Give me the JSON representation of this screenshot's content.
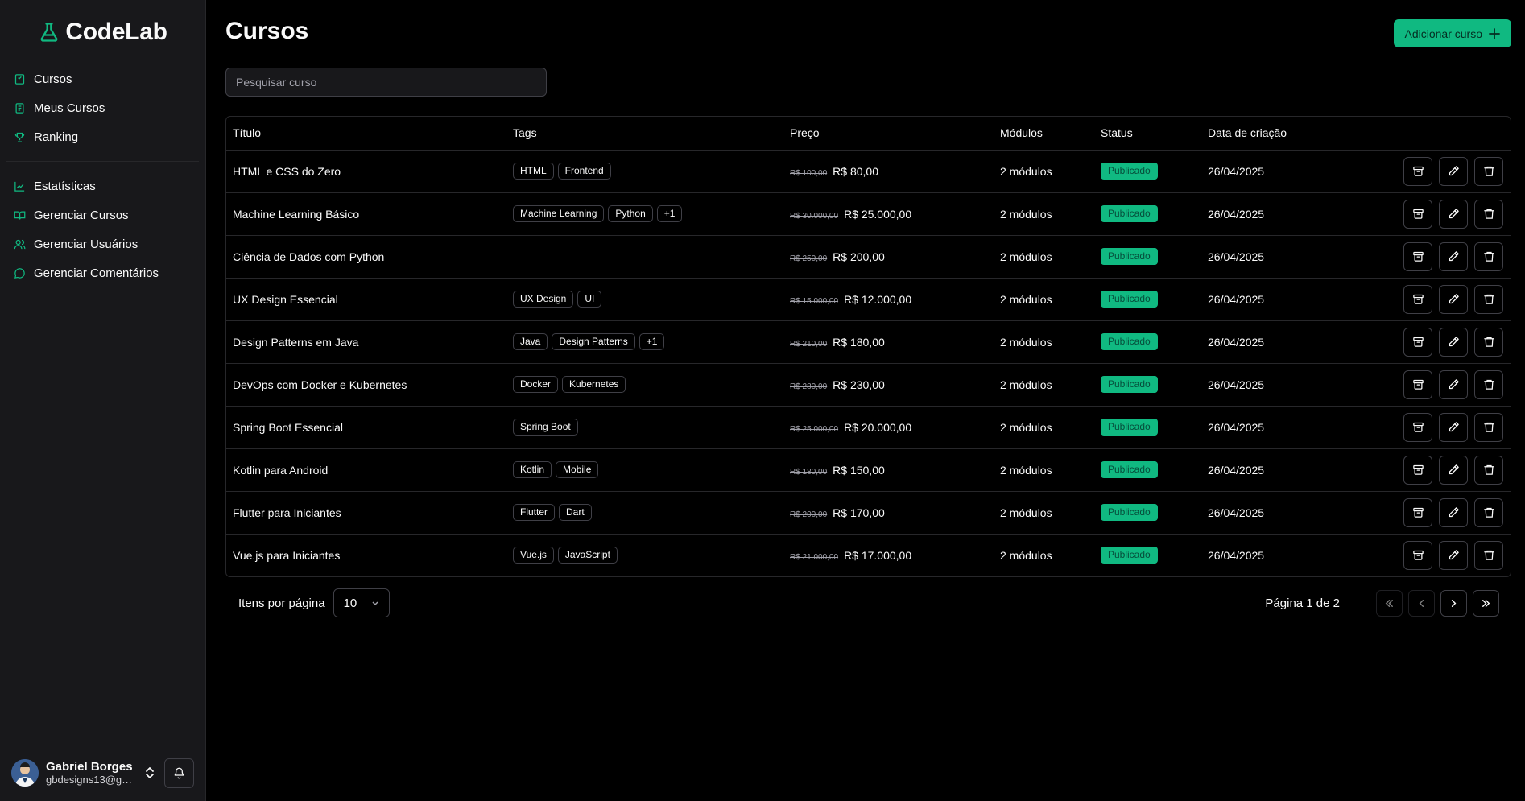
{
  "app": {
    "name": "CodeLab"
  },
  "sidebar": {
    "primary": [
      {
        "label": "Cursos",
        "icon": "book-icon"
      },
      {
        "label": "Meus Cursos",
        "icon": "book-marked-icon"
      },
      {
        "label": "Ranking",
        "icon": "trophy-icon"
      }
    ],
    "admin": [
      {
        "label": "Estatísticas",
        "icon": "chart-icon"
      },
      {
        "label": "Gerenciar Cursos",
        "icon": "book-open-icon"
      },
      {
        "label": "Gerenciar Usuários",
        "icon": "users-icon"
      },
      {
        "label": "Gerenciar Comentários",
        "icon": "message-icon"
      }
    ]
  },
  "user": {
    "name": "Gabriel Borges",
    "email": "gbdesigns13@gma..."
  },
  "header": {
    "title": "Cursos",
    "add_label": "Adicionar curso"
  },
  "search": {
    "placeholder": "Pesquisar curso"
  },
  "table": {
    "columns": [
      "Título",
      "Tags",
      "Preço",
      "Módulos",
      "Status",
      "Data de criação"
    ],
    "rows": [
      {
        "title": "HTML e CSS do Zero",
        "tags": [
          "HTML",
          "Frontend"
        ],
        "old_price": "R$ 100,00",
        "price": "R$ 80,00",
        "modules": "2 módulos",
        "status": "Publicado",
        "date": "26/04/2025"
      },
      {
        "title": "Machine Learning Básico",
        "tags": [
          "Machine Learning",
          "Python",
          "+1"
        ],
        "old_price": "R$ 30.000,00",
        "price": "R$ 25.000,00",
        "modules": "2 módulos",
        "status": "Publicado",
        "date": "26/04/2025"
      },
      {
        "title": "Ciência de Dados com Python",
        "tags": [],
        "old_price": "R$ 250,00",
        "price": "R$ 200,00",
        "modules": "2 módulos",
        "status": "Publicado",
        "date": "26/04/2025"
      },
      {
        "title": "UX Design Essencial",
        "tags": [
          "UX Design",
          "UI"
        ],
        "old_price": "R$ 15.000,00",
        "price": "R$ 12.000,00",
        "modules": "2 módulos",
        "status": "Publicado",
        "date": "26/04/2025"
      },
      {
        "title": "Design Patterns em Java",
        "tags": [
          "Java",
          "Design Patterns",
          "+1"
        ],
        "old_price": "R$ 210,00",
        "price": "R$ 180,00",
        "modules": "2 módulos",
        "status": "Publicado",
        "date": "26/04/2025"
      },
      {
        "title": "DevOps com Docker e Kubernetes",
        "tags": [
          "Docker",
          "Kubernetes"
        ],
        "old_price": "R$ 280,00",
        "price": "R$ 230,00",
        "modules": "2 módulos",
        "status": "Publicado",
        "date": "26/04/2025"
      },
      {
        "title": "Spring Boot Essencial",
        "tags": [
          "Spring Boot"
        ],
        "old_price": "R$ 25.000,00",
        "price": "R$ 20.000,00",
        "modules": "2 módulos",
        "status": "Publicado",
        "date": "26/04/2025"
      },
      {
        "title": "Kotlin para Android",
        "tags": [
          "Kotlin",
          "Mobile"
        ],
        "old_price": "R$ 180,00",
        "price": "R$ 150,00",
        "modules": "2 módulos",
        "status": "Publicado",
        "date": "26/04/2025"
      },
      {
        "title": "Flutter para Iniciantes",
        "tags": [
          "Flutter",
          "Dart"
        ],
        "old_price": "R$ 200,00",
        "price": "R$ 170,00",
        "modules": "2 módulos",
        "status": "Publicado",
        "date": "26/04/2025"
      },
      {
        "title": "Vue.js para Iniciantes",
        "tags": [
          "Vue.js",
          "JavaScript"
        ],
        "old_price": "R$ 21.000,00",
        "price": "R$ 17.000,00",
        "modules": "2 módulos",
        "status": "Publicado",
        "date": "26/04/2025"
      }
    ]
  },
  "pagination": {
    "per_page_label": "Itens por página",
    "per_page_value": "10",
    "page_info": "Página 1 de 2"
  },
  "colors": {
    "accent": "#10b981",
    "background": "#000000",
    "sidebar": "#18181b",
    "border": "#27272a"
  }
}
